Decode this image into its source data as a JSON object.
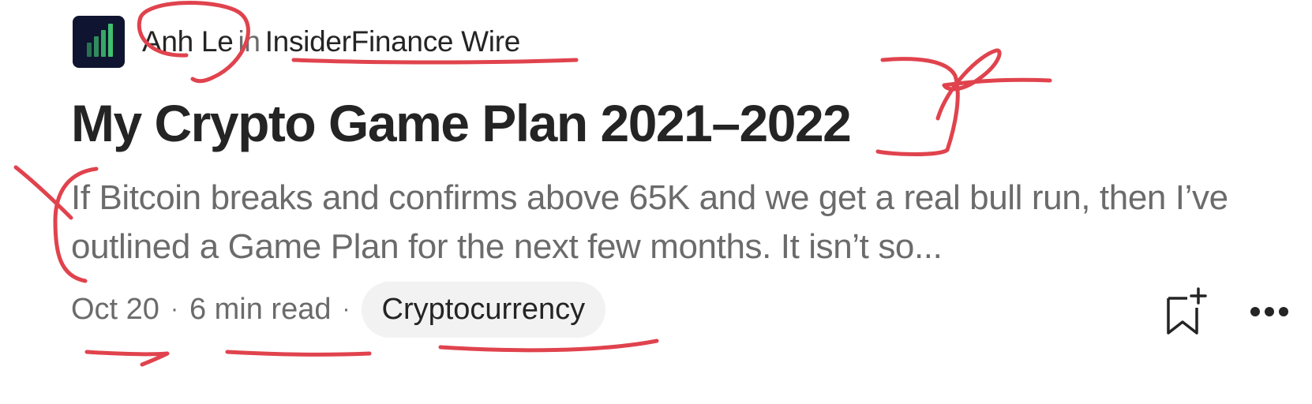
{
  "author": {
    "name": "Anh Le",
    "in_word": "in",
    "publication": "InsiderFinance Wire",
    "logo_icon": "bar-chart-icon",
    "logo_bg": "#0f1430",
    "logo_accent": "#3fbf6f"
  },
  "post": {
    "title": "My Crypto Game Plan 2021–2022",
    "subtitle": "If Bitcoin breaks and confirms above 65K and we get a real bull run, then I’ve outlined a Game Plan for the next few months. It isn’t so..."
  },
  "meta": {
    "date": "Oct 20",
    "separator": "·",
    "read_time": "6 min read",
    "tag": "Cryptocurrency"
  },
  "actions": {
    "save_icon": "bookmark-add-icon",
    "more_icon": "more-horizontal-icon"
  },
  "annotation_color": "#e0434d"
}
